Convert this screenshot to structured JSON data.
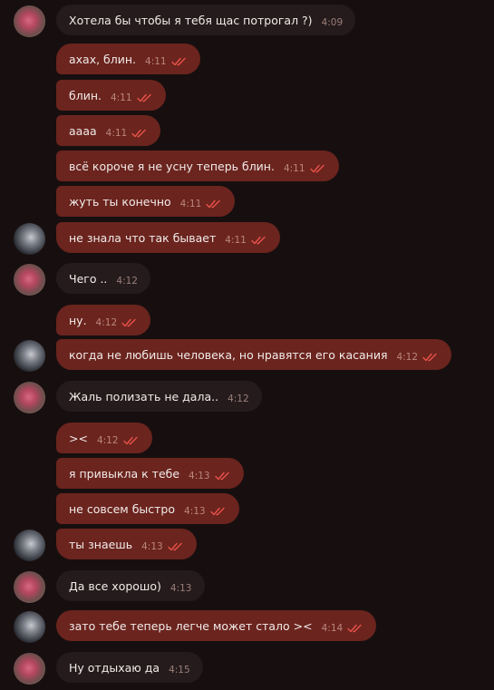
{
  "colors": {
    "background": "#170f0f",
    "incoming_bubble": "#251b1c",
    "outgoing_bubble": "#6b241e",
    "read_checks": "#e9524a"
  },
  "messages": [
    {
      "dir": "in",
      "avatar": "pink",
      "text": "Хотела бы чтобы я тебя щас потрогал ?)",
      "time": "4:09",
      "read": false
    },
    {
      "dir": "out",
      "avatar": "",
      "text": "ахах, блин.",
      "time": "4:11",
      "read": true
    },
    {
      "dir": "out",
      "avatar": "",
      "text": "блин.",
      "time": "4:11",
      "read": true
    },
    {
      "dir": "out",
      "avatar": "",
      "text": "аааа",
      "time": "4:11",
      "read": true
    },
    {
      "dir": "out",
      "avatar": "",
      "text": "всё короче я не усну теперь блин.",
      "time": "4:11",
      "read": true
    },
    {
      "dir": "out",
      "avatar": "",
      "text": "жуть ты конечно",
      "time": "4:11",
      "read": true
    },
    {
      "dir": "out",
      "avatar": "dark",
      "text": "не знала что так бывает",
      "time": "4:11",
      "read": true
    },
    {
      "dir": "in",
      "avatar": "pink",
      "text": "Чего ..",
      "time": "4:12",
      "read": false
    },
    {
      "dir": "out",
      "avatar": "",
      "text": "ну.",
      "time": "4:12",
      "read": true
    },
    {
      "dir": "out",
      "avatar": "dark",
      "text": "когда не любишь человека, но нравятся его касания",
      "time": "4:12",
      "read": true
    },
    {
      "dir": "in",
      "avatar": "pink",
      "text": "Жаль полизать не дала..",
      "time": "4:12",
      "read": false
    },
    {
      "dir": "out",
      "avatar": "",
      "text": "><",
      "time": "4:12",
      "read": true
    },
    {
      "dir": "out",
      "avatar": "",
      "text": "я привыкла к тебе",
      "time": "4:13",
      "read": true
    },
    {
      "dir": "out",
      "avatar": "",
      "text": "не совсем быстро",
      "time": "4:13",
      "read": true
    },
    {
      "dir": "out",
      "avatar": "dark",
      "text": "ты знаешь",
      "time": "4:13",
      "read": true
    },
    {
      "dir": "in",
      "avatar": "pink",
      "text": "Да все хорошо)",
      "time": "4:13",
      "read": false
    },
    {
      "dir": "out",
      "avatar": "dark",
      "text": "зато тебе теперь легче может стало ><",
      "time": "4:14",
      "read": true
    },
    {
      "dir": "in",
      "avatar": "pink",
      "text": "Ну отдыхаю да",
      "time": "4:15",
      "read": false
    }
  ]
}
